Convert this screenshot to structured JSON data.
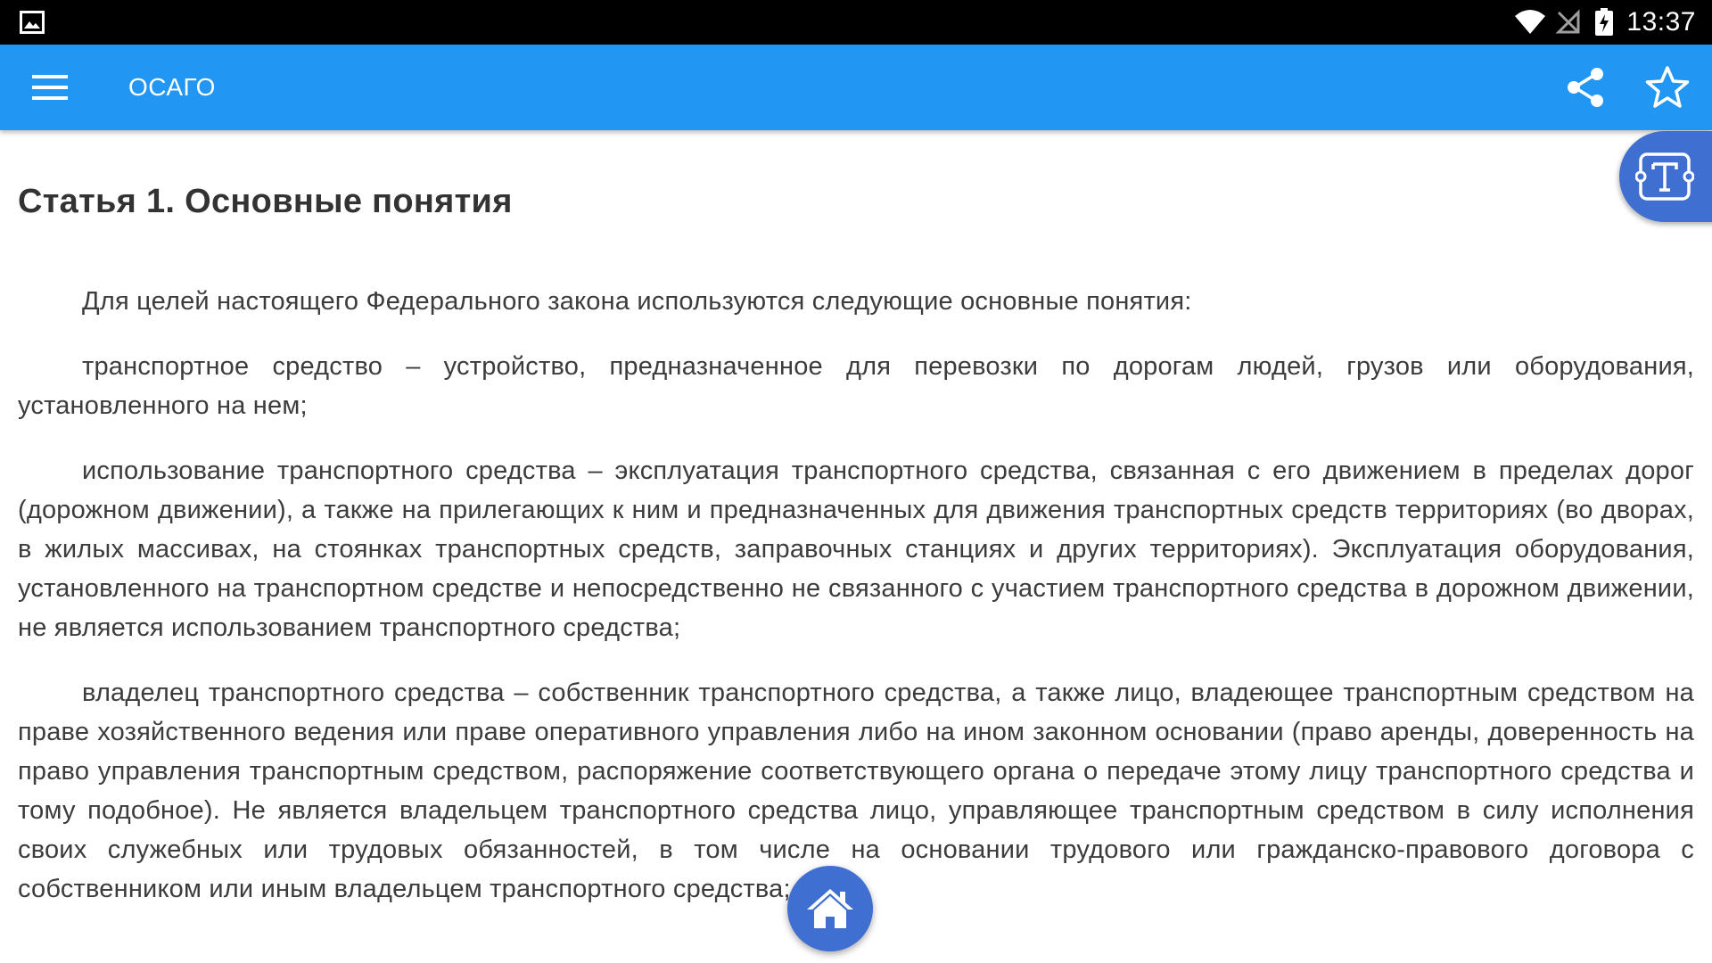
{
  "status_bar": {
    "time": "13:37",
    "icons": [
      "image-notification-icon",
      "wifi-icon",
      "no-signal-icon",
      "battery-charging-icon"
    ]
  },
  "app_bar": {
    "title": "ОСАГО",
    "menu_icon": "menu-icon",
    "share_icon": "share-icon",
    "favorite_icon": "star-icon",
    "color": "#2196F3"
  },
  "text_size_button": {
    "icon": "text-size-icon",
    "color": "#3F6FD1"
  },
  "article": {
    "heading": "Статья 1. Основные понятия",
    "paragraphs": [
      "Для целей настоящего Федерального закона используются следующие основные понятия:",
      "транспортное средство – устройство, предназначенное для перевозки по дорогам людей, грузов или оборудования, установленного на нем;",
      "использование транспортного средства – эксплуатация транспортного средства, связанная с его движением в пределах дорог (дорожном движении), а также на прилегающих к ним и предназначенных для движения транспортных средств территориях (во дворах, в жилых массивах, на стоянках транспортных средств, заправочных станциях и других территориях). Эксплуатация оборудования, установленного на транспортном средстве и непосредственно не связанного с участием транспортного средства в дорожном движении, не является использованием транспортного средства;",
      "владелец транспортного средства – собственник транспортного средства, а также лицо, владеющее транспортным средством на праве хозяйственного ведения или праве оперативного управления либо на ином законном основании (право аренды, доверенность на право управления транспортным средством, распоряжение соответствующего органа о передаче этому лицу транспортного средства и тому подобное). Не является владельцем транспортного средства лицо, управляющее транспортным средством в силу исполнения своих служебных или трудовых обязанностей, в том числе на основании трудового или гражданско-правового договора с собственником или иным владельцем транспортного средства;"
    ]
  },
  "home_button": {
    "icon": "home-icon",
    "color": "#3F6FD1"
  }
}
